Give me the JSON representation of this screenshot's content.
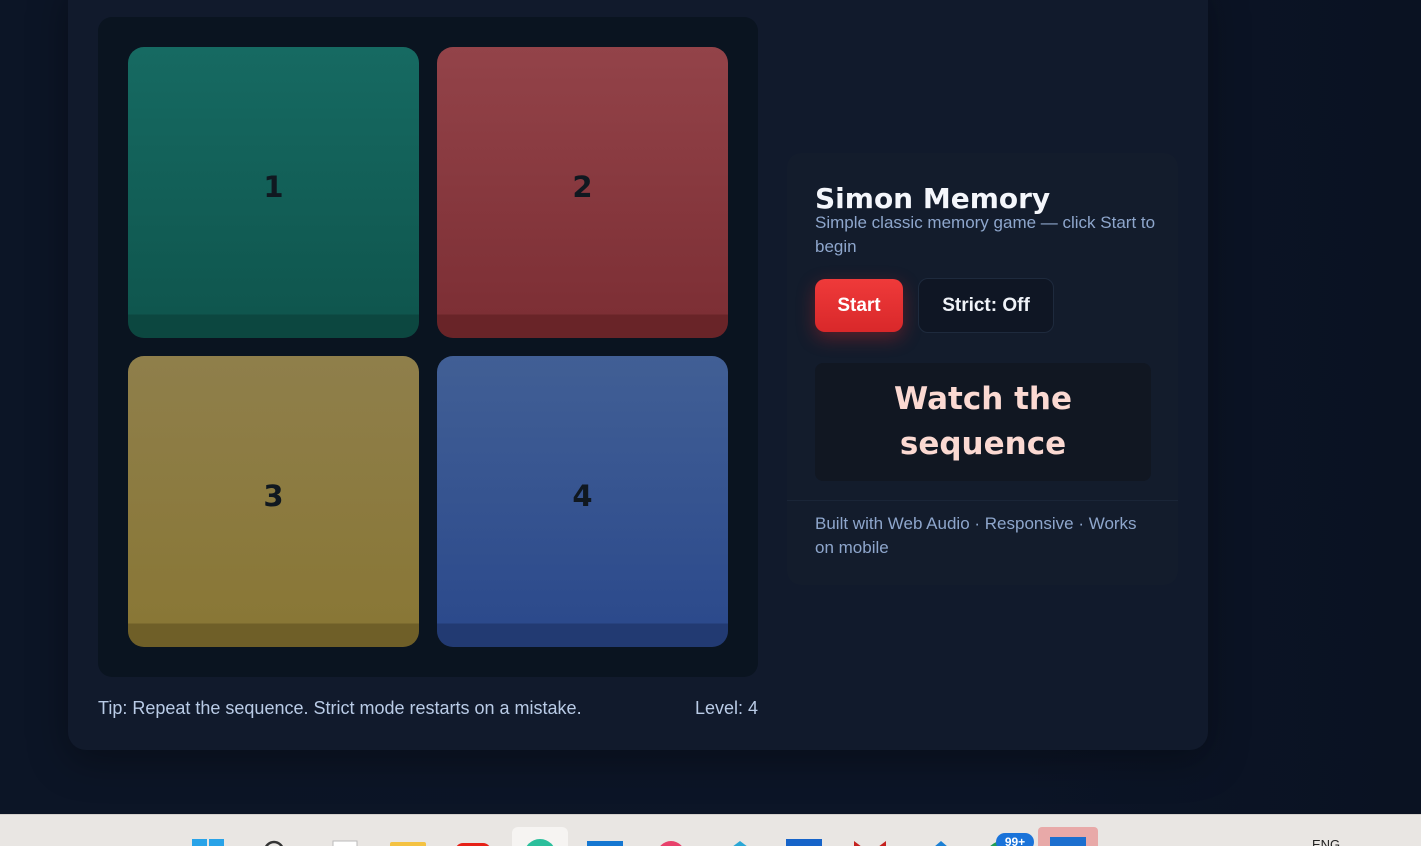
{
  "game": {
    "title": "Simon Memory",
    "subtitle": "Simple classic memory game — click Start to begin",
    "start_label": "Start",
    "strict_label": "Strict: Off",
    "status": "Watch the sequence",
    "footer": "Built with Web Audio · Responsive · Works on mobile",
    "tip": "Tip: Repeat the sequence. Strict mode restarts on a mistake.",
    "level": "Level: 4"
  },
  "pads": [
    {
      "label": "1",
      "color": "#166a62"
    },
    {
      "label": "2",
      "color": "#934349"
    },
    {
      "label": "3",
      "color": "#8f7f4b"
    },
    {
      "label": "4",
      "color": "#415f95"
    }
  ],
  "colors": {
    "background": "#0b1324",
    "card": "#111a2c",
    "accent_red": "#ef3a3a",
    "status_text": "#fbd9d2",
    "muted_text": "#8ea6cc"
  },
  "taskbar": {
    "badge": "99+",
    "language": "ENG",
    "icons": [
      "windows-start-icon",
      "search-icon",
      "task-view-icon",
      "file-explorer-icon",
      "youtube-icon",
      "edge-icon",
      "outlook-icon",
      "app-icon",
      "app-icon",
      "mail-icon",
      "gmail-icon",
      "app-icon",
      "whatsapp-icon",
      "app-icon"
    ]
  }
}
